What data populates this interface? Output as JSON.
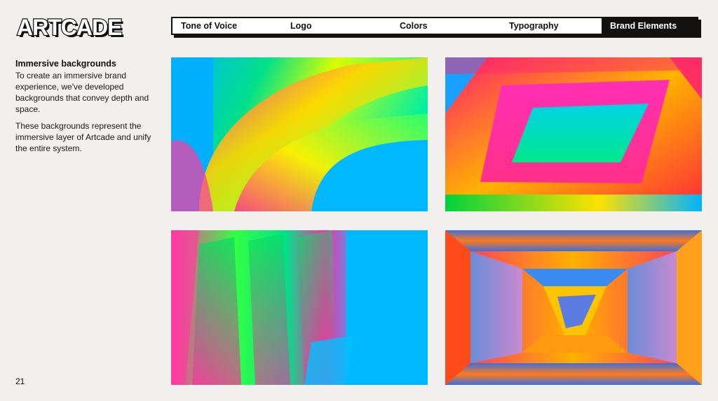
{
  "brand": {
    "logo_text": "ARTCADE"
  },
  "nav": {
    "items": [
      {
        "label": "Tone of Voice"
      },
      {
        "label": "Logo"
      },
      {
        "label": "Colors"
      },
      {
        "label": "Typography"
      },
      {
        "label": "Brand Elements"
      }
    ],
    "active_index": 4
  },
  "section": {
    "heading": "Immersive backgrounds",
    "paragraphs": [
      "To create an immersive brand experience, we've developed backgrounds that convey depth and space.",
      "These backgrounds represent the immersive layer of Artcade and unify the entire system."
    ]
  },
  "page_number": "21",
  "colors": {
    "background": "#f1f0ee",
    "ink": "#111111",
    "nav_active_bg": "#111111",
    "nav_active_text": "#ffffff"
  },
  "images": [
    {
      "icon": "immersive-background-swirl-image"
    },
    {
      "icon": "immersive-background-frame-image"
    },
    {
      "icon": "immersive-background-panels-image"
    },
    {
      "icon": "immersive-background-tunnel-image"
    }
  ]
}
